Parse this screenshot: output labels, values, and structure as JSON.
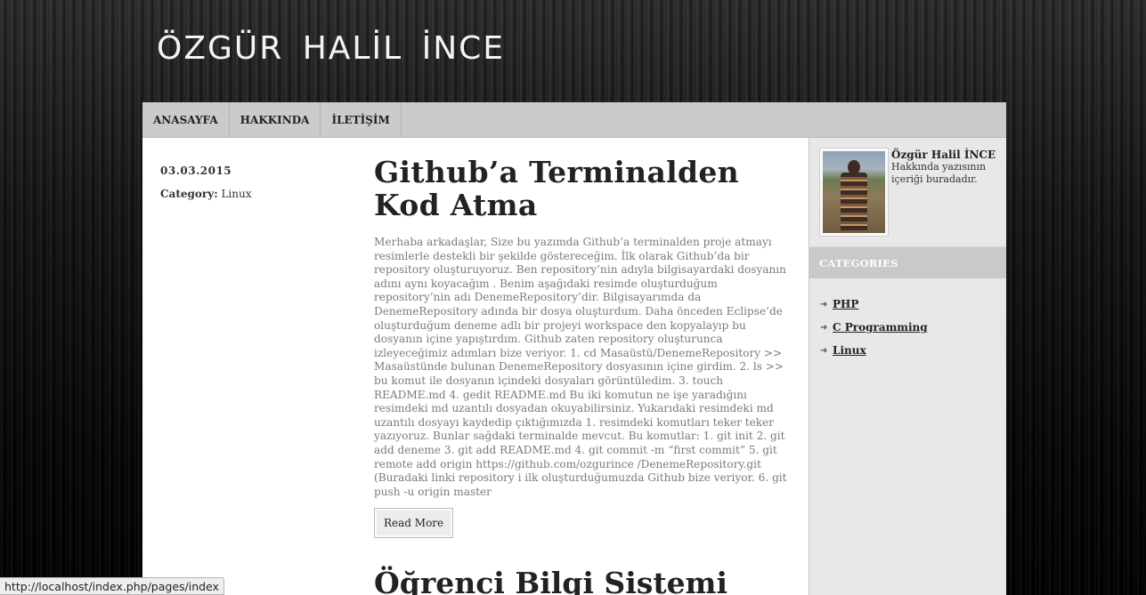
{
  "site": {
    "title": "ÖZGÜR  HALİL  İNCE"
  },
  "nav": {
    "items": [
      {
        "label": "ANASAYFA"
      },
      {
        "label": "HAKKINDA"
      },
      {
        "label": "İLETİŞİM"
      }
    ]
  },
  "post": {
    "date": "03.03.2015",
    "category_label": "Category:",
    "category": "Linux",
    "title": "Github’a Terminalden Kod Atma",
    "excerpt": "Merhaba arkadaşlar, Size bu yazımda Github’a terminalden proje atmayı resimlerle destekli bir şekilde göstereceğim. İlk olarak Github’da bir repository oluşturuyoruz. Ben repository’nin adıyla bilgisayardaki dosyanın adını aynı koyacağım . Benim aşağıdaki resimde oluşturduğum repository’nin adı DenemeRepository’dir. Bilgisayarımda da DenemeRepository adında bir dosya oluşturdum. Daha önceden Eclipse’de oluşturduğum deneme adlı bir projeyi workspace den kopyalayıp bu dosyanın içine yapıştırdım. Github zaten repository oluşturunca izleyeceğimiz adımları bize veriyor. 1. cd Masaüstü/DenemeRepository >> Masaüstünde bulunan DenemeRepository dosyasının içine girdim. 2. ls >> bu komut ile dosyanın içindeki dosyaları görüntüledim. 3. touch README.md 4. gedit README.md Bu iki komutun ne işe yaradığını resimdeki md uzantılı dosyadan okuyabilirsiniz. Yukarıdaki resimdeki md uzantılı dosyayı kaydedip çıktığımızda 1. resimdeki komutları teker teker yazıyoruz. Bunlar sağdaki terminalde mevcut. Bu komutlar: 1. git init 2. git add deneme 3. git add README.md 4. git commit -m “first commit” 5. git remote add origin https://github.com/ozgurince /DenemeRepository.git (Buradaki linki repository i ilk oluşturduğumuzda Github bize veriyor. 6. git push -u origin master",
    "read_more": "Read More"
  },
  "next_post": {
    "title": "Öğrenci Bilgi Sistemi"
  },
  "sidebar": {
    "profile": {
      "name": "Özgür Halil İNCE",
      "description": "Hakkında yazısının içeriği buradadır."
    },
    "categories_header": "CATEGORIES",
    "categories": [
      {
        "label": "PHP"
      },
      {
        "label": "C Programming"
      },
      {
        "label": "Linux"
      }
    ]
  },
  "statusbar": {
    "url": "http://localhost/index.php/pages/index"
  }
}
